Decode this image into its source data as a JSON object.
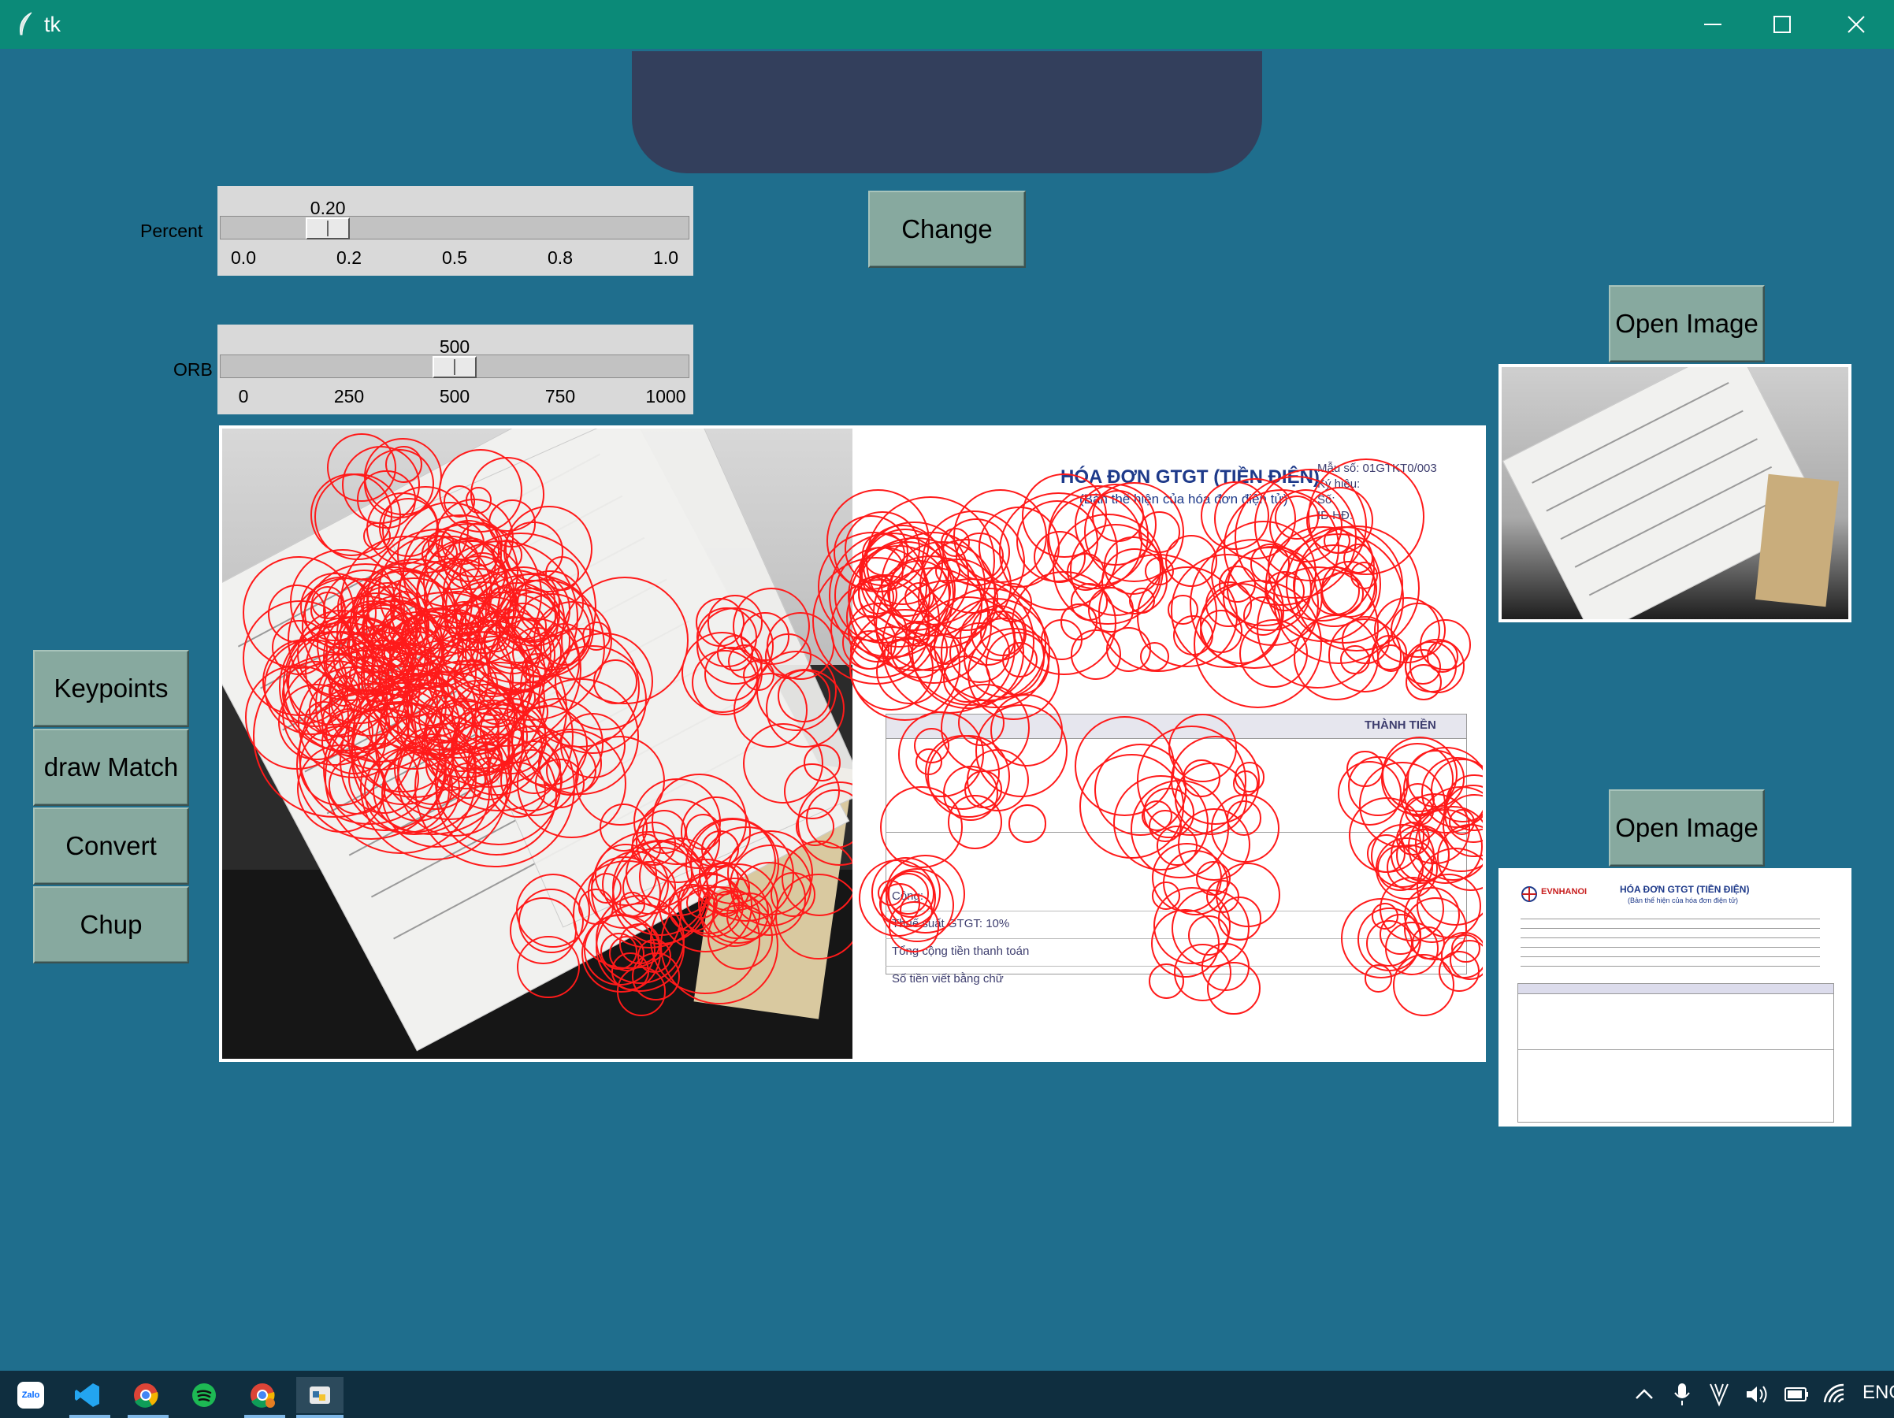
{
  "window": {
    "title": "tk"
  },
  "buttons": {
    "change": "Change",
    "open_image_1": "Open Image",
    "open_image_2": "Open Image",
    "keypoints": "Keypoints",
    "draw_match": "draw Match",
    "convert": "Convert",
    "chup": "Chup"
  },
  "percent_scale": {
    "label": "Percent",
    "value_text": "0.20",
    "value": 0.2,
    "min": 0.0,
    "max": 1.0,
    "ticks": [
      "0.0",
      "0.2",
      "0.5",
      "0.8",
      "1.0"
    ]
  },
  "orb_scale": {
    "label": "ORB",
    "value_text": "500",
    "value": 500,
    "min": 0,
    "max": 1000,
    "ticks": [
      "0",
      "250",
      "500",
      "750",
      "1000"
    ]
  },
  "match_image": {
    "doc_title": "HÓA ĐƠN GTGT (TIỀN ĐIỆN)",
    "doc_subtitle": "(Bản thể hiện của hóa đơn điện tử)",
    "doc_form": "Mẫu số: 01GTKT0/003",
    "doc_symbol": "Ký hiệu:",
    "doc_no": "Số:",
    "doc_id": "ID HĐ:",
    "col_total": "THÀNH TIỀN",
    "row_cong": "Cộng:",
    "row_vat": "Thuế suất GTGT: 10%",
    "row_total": "Tổng cộng tiền thanh toán",
    "row_words": "Số tiền viết bằng chữ"
  },
  "preview_doc": {
    "title": "HÓA ĐƠN GTGT (TIỀN ĐIỆN)",
    "subtitle": "(Bản thể hiện của hóa đơn điện tử)",
    "brand": "EVNHANOI"
  },
  "taskbar": {
    "lang": "ENG",
    "icons": [
      "zalo-icon",
      "vscode-icon",
      "chrome-icon",
      "spotify-icon",
      "chrome-profile-icon",
      "python-tk-icon"
    ],
    "zalo_label": "Zalo"
  }
}
